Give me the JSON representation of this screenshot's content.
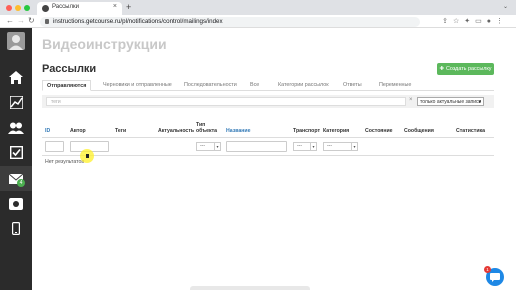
{
  "browser": {
    "tab_title": "Рассылки",
    "tab_close": "×",
    "new_tab": "+",
    "url": "instructions.getcourse.ru/pl/notifications/control/mailings/index"
  },
  "sidebar": {
    "items": [
      {
        "icon": "user-avatar-icon"
      },
      {
        "icon": "home-icon"
      },
      {
        "icon": "chart-icon"
      },
      {
        "icon": "users-icon"
      },
      {
        "icon": "checkbox-icon"
      },
      {
        "icon": "mail-icon",
        "badge": "4"
      },
      {
        "icon": "video-icon"
      },
      {
        "icon": "mobile-icon"
      }
    ]
  },
  "page": {
    "title": "Видеоинструкции",
    "subtitle": "Рассылки",
    "create_button": "Создать рассылку"
  },
  "tabs": [
    {
      "label": "Отправляются",
      "active": true
    },
    {
      "label": "Черновики и отправленные",
      "active": false
    },
    {
      "label": "Последовательности",
      "active": false
    },
    {
      "label": "Все",
      "active": false
    },
    {
      "label": "Категории рассылок",
      "active": false
    },
    {
      "label": "Ответы",
      "active": false
    },
    {
      "label": "Переменные",
      "active": false
    }
  ],
  "filter": {
    "tags_placeholder": "теги",
    "clear": "×",
    "select_value": "только актуальные записи"
  },
  "table": {
    "headers": {
      "id": "ID",
      "author": "Автор",
      "tags": "Теги",
      "actuality": "Актуальность",
      "object_type": "Тип объекта",
      "name": "Название",
      "transport": "Транспорт",
      "category": "Категория",
      "state": "Состояние",
      "messages": "Сообщения",
      "stats": "Статистика"
    },
    "select_placeholder": "---",
    "empty": "Нет результатов"
  },
  "chat": {
    "badge": "1"
  },
  "colors": {
    "sidebar": "#2b2b2b",
    "accent_green": "#5cb85c",
    "link_blue": "#337ab7",
    "chat_blue": "#1e88e5"
  }
}
